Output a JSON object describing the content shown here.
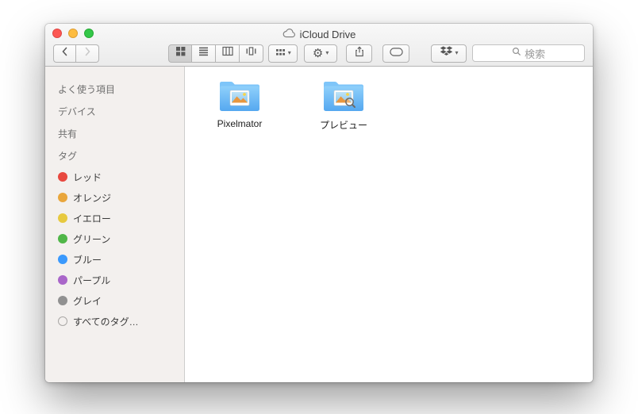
{
  "window": {
    "title": "iCloud Drive"
  },
  "icons": {
    "chevron_down": "▾",
    "gear": "⚙"
  },
  "toolbar": {
    "search_placeholder": "検索"
  },
  "sidebar": {
    "sections": [
      "よく使う項目",
      "デバイス",
      "共有",
      "タグ"
    ],
    "tags": [
      {
        "label": "レッド",
        "color": "#e8483f"
      },
      {
        "label": "オレンジ",
        "color": "#e9a63c"
      },
      {
        "label": "イエロー",
        "color": "#e7c93f"
      },
      {
        "label": "グリーン",
        "color": "#50b648"
      },
      {
        "label": "ブルー",
        "color": "#3a99fd"
      },
      {
        "label": "パープル",
        "color": "#a966c9"
      },
      {
        "label": "グレイ",
        "color": "#919191"
      },
      {
        "label": "すべてのタグ…",
        "color": "",
        "hollow": true
      }
    ]
  },
  "content": {
    "items": [
      {
        "label": "Pixelmator"
      },
      {
        "label": "プレビュー"
      }
    ]
  }
}
